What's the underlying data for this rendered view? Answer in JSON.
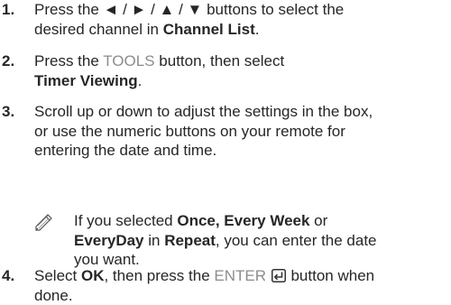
{
  "steps": [
    {
      "number": "1.",
      "line1_pre": "Press the ",
      "arrows": "◄ / ► / ▲ / ▼",
      "line1_post": " buttons to select the",
      "line2_pre": "desired channel in ",
      "line2_bold": "Channel List",
      "line2_post": "."
    },
    {
      "number": "2.",
      "line1_pre": "Press the ",
      "key": "TOOLS",
      "line1_post": " button, then select",
      "line2_bold": "Timer Viewing",
      "line2_post": "."
    },
    {
      "number": "3.",
      "line1": "Scroll up or down to adjust the settings in the box,",
      "line2": "or use the numeric buttons on your remote for",
      "line3": "entering the date and time."
    },
    {
      "number": "4.",
      "line1_pre": "Select ",
      "line1_bold": "OK",
      "line1_mid": ", then press the ",
      "key": "ENTER",
      "line1_post": " button when",
      "line2": "done."
    }
  ],
  "note": {
    "icon": "pencil-note-icon",
    "line1_pre": "If you selected ",
    "line1_bold": "Once, Every Week",
    "line1_post": " or",
    "line2_bold1": "EveryDay",
    "line2_mid": " in ",
    "line2_bold2": "Repeat",
    "line2_post": ", you can enter the date",
    "line3": "you want."
  },
  "enter_icon": "enter-key-icon"
}
